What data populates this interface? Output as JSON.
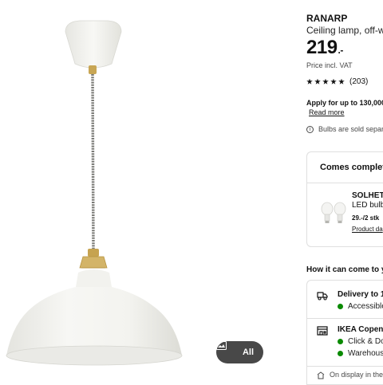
{
  "gallery": {
    "all_button_label": "All"
  },
  "product": {
    "brand": "RANARP",
    "description": "Ceiling lamp, off-wh",
    "price_main": "219",
    "price_suffix": ".-",
    "vat_note": "Price incl. VAT",
    "rating_stars": 5,
    "rating_count": "(203)",
    "apply_text": "Apply for up to 130,000.-",
    "read_more": "Read more",
    "bulbs_note": "Bulbs are sold separa"
  },
  "comes_complete": {
    "heading": "Comes complete",
    "item_name": "SOLHETT",
    "item_desc": "LED bulb",
    "item_price": "29.-/2 stk",
    "item_link": "Product da"
  },
  "availability": {
    "heading": "How it can come to y",
    "delivery_title": "Delivery to 1",
    "delivery_status": "Accessible",
    "store_title": "IKEA Copenh",
    "store_click": "Click & Do",
    "store_warehouse": "Warehous",
    "display_note": "On display in the c"
  },
  "colors": {
    "status_green": "#0a8a00",
    "button_dark": "#484848"
  }
}
